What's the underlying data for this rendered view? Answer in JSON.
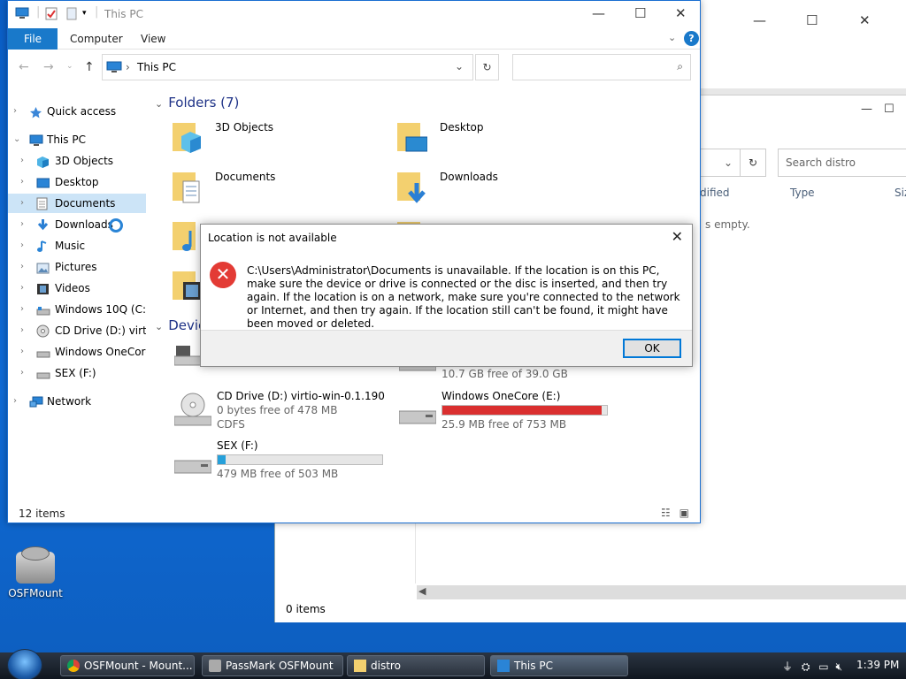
{
  "desktop_icon": {
    "label": "OSFMount"
  },
  "bg_window": {
    "search_placeholder": "Search distro",
    "columns": [
      "dified",
      "Type",
      "Siz"
    ],
    "empty_text": "s empty.",
    "status": "0 items"
  },
  "window": {
    "title": "This PC",
    "menu": {
      "file": "File",
      "computer": "Computer",
      "view": "View"
    },
    "address": "This PC",
    "status": "12 items"
  },
  "nav": {
    "items": [
      {
        "label": "Quick access",
        "icon": "star-icon",
        "level": 0
      },
      {
        "label": "This PC",
        "icon": "pc-icon",
        "level": 0
      },
      {
        "label": "3D Objects",
        "icon": "cube-icon",
        "level": 1
      },
      {
        "label": "Desktop",
        "icon": "desktop-icon",
        "level": 1
      },
      {
        "label": "Documents",
        "icon": "document-icon",
        "level": 1
      },
      {
        "label": "Downloads",
        "icon": "download-icon",
        "level": 1
      },
      {
        "label": "Music",
        "icon": "music-icon",
        "level": 1
      },
      {
        "label": "Pictures",
        "icon": "picture-icon",
        "level": 1
      },
      {
        "label": "Videos",
        "icon": "video-icon",
        "level": 1
      },
      {
        "label": "Windows 10Q (C:)",
        "icon": "drive-icon",
        "level": 1
      },
      {
        "label": "CD Drive (D:) virtio-",
        "icon": "cd-icon",
        "level": 1
      },
      {
        "label": "Windows OneCore",
        "icon": "drive-icon",
        "level": 1
      },
      {
        "label": "SEX (F:)",
        "icon": "drive-icon",
        "level": 1
      },
      {
        "label": "Network",
        "icon": "network-icon",
        "level": 0
      }
    ]
  },
  "folders": {
    "heading": "Folders (7)",
    "items": [
      {
        "name": "3D Objects",
        "icon": "cube-folder-icon"
      },
      {
        "name": "Desktop",
        "icon": "desktop-folder-icon"
      },
      {
        "name": "Documents",
        "icon": "document-folder-icon"
      },
      {
        "name": "Downloads",
        "icon": "download-folder-icon"
      }
    ]
  },
  "devices": {
    "heading": "Devic",
    "items": [
      {
        "name": "",
        "free": "10.7 GB free of 39.0 GB"
      },
      {
        "name": "CD Drive (D:) virtio-win-0.1.190",
        "free": "0 bytes free of 478 MB",
        "fs": "CDFS"
      },
      {
        "name": "Windows OneCore (E:)",
        "free": "25.9 MB free of 753 MB",
        "used_fraction": 0.97,
        "bar_color": "#da2f2f"
      },
      {
        "name": "SEX (F:)",
        "free": "479 MB free of 503 MB",
        "used_fraction": 0.05,
        "bar_color": "#26a0da"
      }
    ]
  },
  "dialog": {
    "title": "Location is not available",
    "message": "C:\\Users\\Administrator\\Documents is unavailable. If the location is on this PC, make sure the device or drive is connected or the disc is inserted, and then try again. If the location is on a network, make sure you're connected to the network or Internet, and then try again. If the location still can't be found, it might have been moved or deleted.",
    "ok": "OK"
  },
  "taskbar": {
    "buttons": [
      {
        "label": "OSFMount - Mount..."
      },
      {
        "label": "PassMark OSFMount"
      },
      {
        "label": "distro"
      },
      {
        "label": "This PC"
      }
    ],
    "time": "1:39 PM"
  },
  "colors": {
    "accent": "#1979ca",
    "selection": "#cce4f7",
    "error": "#e33b35"
  }
}
